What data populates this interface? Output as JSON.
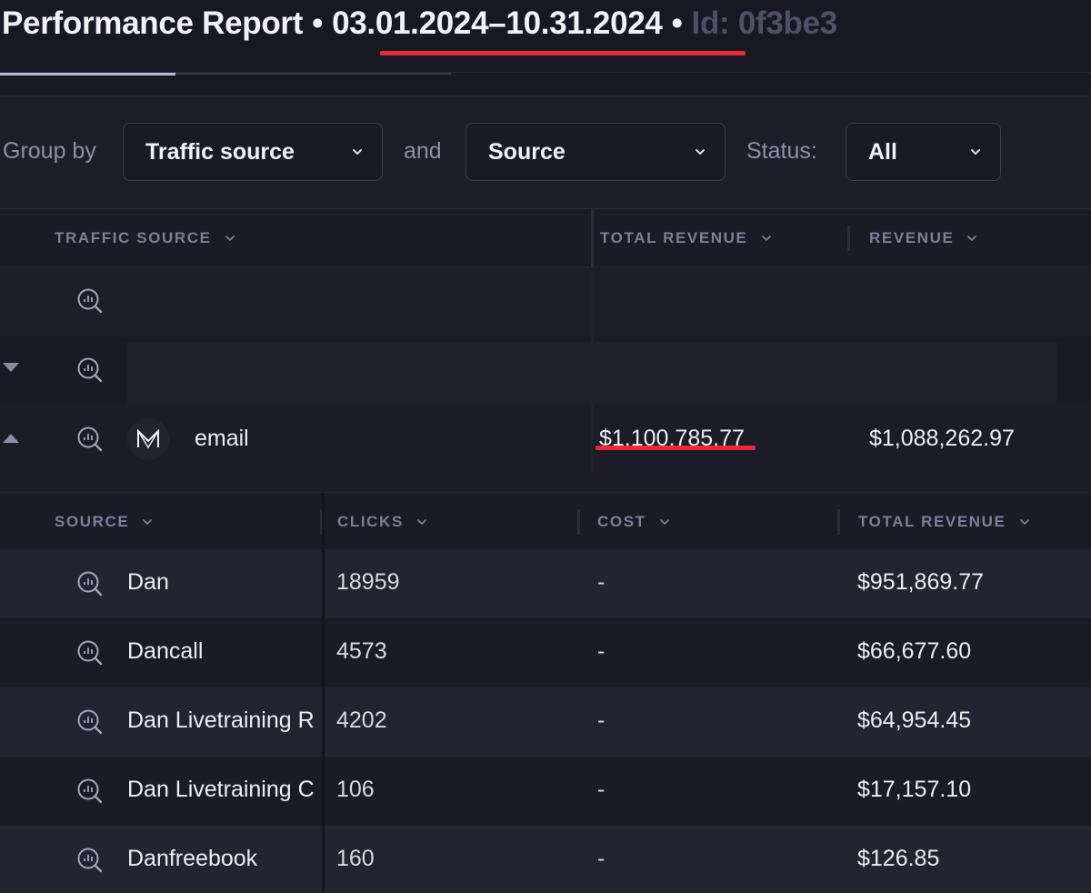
{
  "header": {
    "title": "Performance Report",
    "separator": "•",
    "date_range": "03.01.2024–10.31.2024",
    "id_label": "Id: 0f3be3"
  },
  "filters": {
    "group_by_label": "Group by",
    "group_by_value": "Traffic source",
    "and_label": "and",
    "second_group_value": "Source",
    "status_label": "Status:",
    "status_value": "All"
  },
  "table": {
    "columns": [
      "TRAFFIC SOURCE",
      "TOTAL REVENUE",
      "REVENUE"
    ],
    "rows": [
      {
        "name": "",
        "total_revenue": "",
        "revenue": ""
      },
      {
        "name": "",
        "total_revenue": "",
        "revenue": ""
      },
      {
        "name": "email",
        "total_revenue": "$1.100.785.77",
        "revenue": "$1,088,262.97"
      }
    ]
  },
  "subtable": {
    "columns": [
      "SOURCE",
      "CLICKS",
      "COST",
      "TOTAL REVENUE"
    ],
    "rows": [
      {
        "source": "Dan",
        "clicks": "18959",
        "cost": "-",
        "total_revenue": "$951,869.77"
      },
      {
        "source": "Dancall",
        "clicks": "4573",
        "cost": "-",
        "total_revenue": "$66,677.60"
      },
      {
        "source": "Dan Livetraining R",
        "clicks": "4202",
        "cost": "-",
        "total_revenue": "$64,954.45"
      },
      {
        "source": "Dan Livetraining C",
        "clicks": "106",
        "cost": "-",
        "total_revenue": "$17,157.10"
      },
      {
        "source": "Danfreebook",
        "clicks": "160",
        "cost": "-",
        "total_revenue": "$126.85"
      }
    ]
  },
  "icons": {
    "row_icon": "analytics-search-icon",
    "header_chevron": "chevron-down-icon",
    "expand": "caret-down-icon",
    "collapse": "caret-up-icon",
    "logo": "brand-logo-icon"
  },
  "colors": {
    "background": "#1a1a26",
    "highlight_underline": "#ec2a34",
    "muted_text": "#7d8096"
  }
}
